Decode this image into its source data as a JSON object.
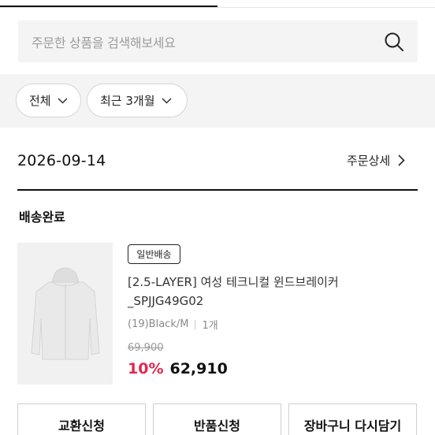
{
  "search": {
    "placeholder": "주문한 상품을 검색해보세요"
  },
  "filters": {
    "all_label": "전체",
    "period_label": "최근 3개월"
  },
  "order": {
    "date": "2026-09-14",
    "detail_label": "주문상세",
    "status": "배송완료",
    "item": {
      "badge": "일반배송",
      "name": "[2.5-LAYER] 여성 테크니컬 윈드브레이커 _SPJJG49G02",
      "option": "(19)Black/M",
      "quantity": "1개",
      "original_price": "69,900",
      "discount": "10%",
      "sale_price": "62,910"
    }
  },
  "actions": {
    "exchange_label": "교환신청",
    "return_label": "반품신청",
    "recart_label": "장바구니 다시담기"
  },
  "colors": {
    "accent": "#e3264f",
    "text": "#111111",
    "muted": "#9b9b9b"
  }
}
